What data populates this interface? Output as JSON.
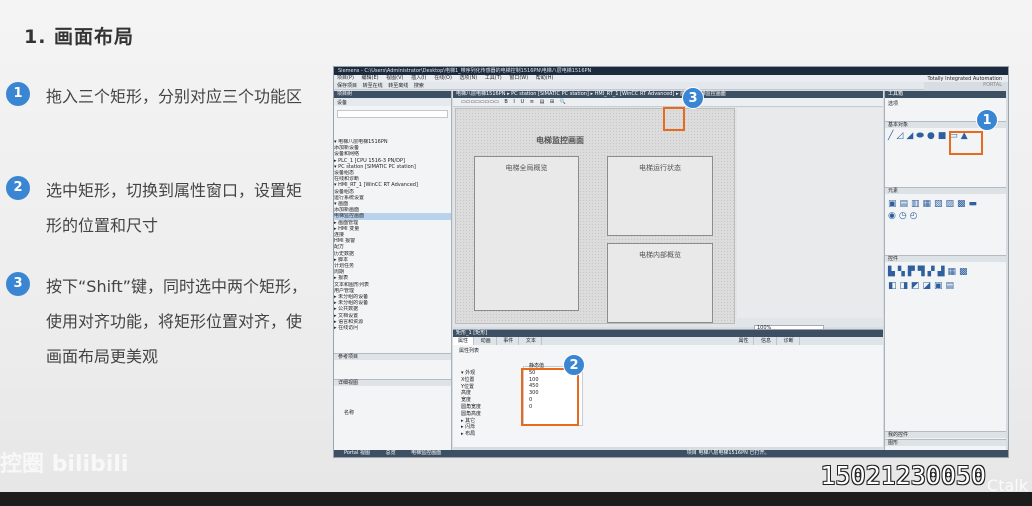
{
  "slide": {
    "title": "1.   画面布局",
    "steps": [
      {
        "num": "1",
        "text": "拖入三个矩形，分别对应三个功能区"
      },
      {
        "num": "2",
        "text": "选中矩形，切换到属性窗口，设置矩形的位置和尺寸"
      },
      {
        "num": "3",
        "text": "按下“Shift”键，同时选中两个矩形，使用对齐功能，将矩形位置对齐，使画面布局更美观"
      }
    ],
    "watermark": "控圈 bilibili",
    "phone": "15021230050",
    "brand": "Ctalk"
  },
  "screenshot": {
    "window_title": "Siemens - C:\\Users\\Administrator\\Desktop\\电梯1_带序列化传感器的电梯控制1516PN\\电梯八层电梯1516PN",
    "menu": [
      "项目(P)",
      "编辑(E)",
      "视图(V)",
      "插入(I)",
      "在线(O)",
      "选项(N)",
      "工具(T)",
      "窗口(W)",
      "帮助(H)"
    ],
    "toolbar": [
      "保存项目",
      "转至在线",
      "转至离线",
      "搜索"
    ],
    "brand_line1": "Totally Integrated Automation",
    "brand_line2": "PORTAL",
    "breadcrumb": "电梯八层电梯1516PN ▸ PC station [SIMATIC PC station] ▸ HMI_RT_1 [WinCC RT Advanced] ▸ 画面 ▸ 电梯监控画面",
    "left_pane_title": "项目树",
    "device_tab": "设备",
    "tree": [
      "▾ 电梯八层电梯1516PN",
      "   添加新设备",
      "   设备和网络",
      " ▸ PLC_1 [CPU 1516-3 PN/DP]",
      " ▾ PC station [SIMATIC PC station]",
      "    设备组态",
      "    在线和诊断",
      "  ▾ HMI_RT_1 [WinCC RT Advanced]",
      "     设备组态",
      "     运行系统设置",
      "   ▾ 画面",
      "       添加新画面",
      "       电梯监控画面",
      "   ▸ 画面管理",
      "   ▸ HMI 变量",
      "     连接",
      "     HMI 报警",
      "     配方",
      "     历史数据",
      "   ▸ 脚本",
      "     计划任务",
      "     周期",
      "   ▸ 报表",
      "     文本和图形列表",
      "     用户管理",
      " ▸ 未分组的设备",
      " ▸ 未分组的设备",
      " ▸ 公共数据",
      " ▸ 文档设置",
      " ▸ 语言和资源",
      " ▸ 在线访问"
    ],
    "details_header": "参考项目",
    "details_view": "详细视图",
    "name_col": "名称",
    "canvas_title": "电梯监控画面",
    "rects": [
      "电梯全局概览",
      "电梯运行状态",
      "电梯内部概览"
    ],
    "zoom": "100%",
    "inspector_tabs": [
      "属性",
      "动画",
      "事件",
      "文本"
    ],
    "inspector_right_tabs": [
      "属性",
      "信息",
      "诊断"
    ],
    "inspector_section": "矩形_1 [矩形]",
    "attr_label": "属性列表",
    "attr_rows": [
      "▾ 外观",
      "    X位置",
      "    Y位置",
      "    高度",
      "    宽度",
      "    圆角宽度",
      "    圆角高度",
      " ▸ 其它",
      " ▸ 闪烁",
      " ▸ 布局"
    ],
    "attr_vals": [
      "静态值",
      "50",
      "100",
      "450",
      "300",
      "0",
      "0"
    ],
    "right_pane_title": "工具箱",
    "options_label": "选项",
    "section_basic": "基本对象",
    "section_elements": "元素",
    "section_controls": "控件",
    "section_my_controls": "我的控件",
    "section_graphics": "图形",
    "status_items": [
      "Portal 视图",
      "总览",
      "电梯监控画面"
    ],
    "status_msg": "项目 电梯八层电梯1516PN 已打开。",
    "badges": [
      "1",
      "2",
      "3"
    ]
  }
}
